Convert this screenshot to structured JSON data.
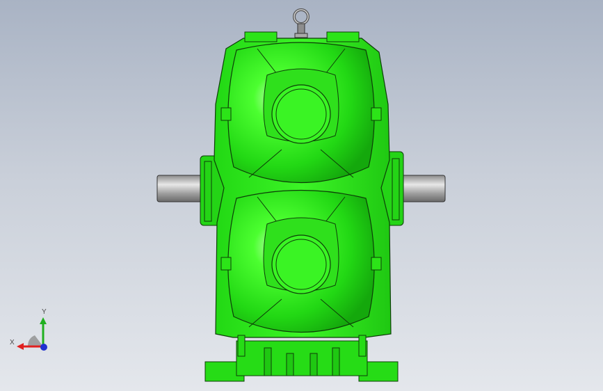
{
  "viewport": {
    "background_top": "#a9b3c4",
    "background_bottom": "#e4e7ec"
  },
  "model": {
    "name": "",
    "body_color": "#2ef01a",
    "body_dark": "#1a8a10",
    "shaft_color": "#9a9a9a",
    "outline_color": "#0d3d08"
  },
  "triad": {
    "x_label": "X",
    "y_label": "Y",
    "x_color": "#e02020",
    "y_color": "#20b020",
    "z_color": "#2030d0"
  }
}
